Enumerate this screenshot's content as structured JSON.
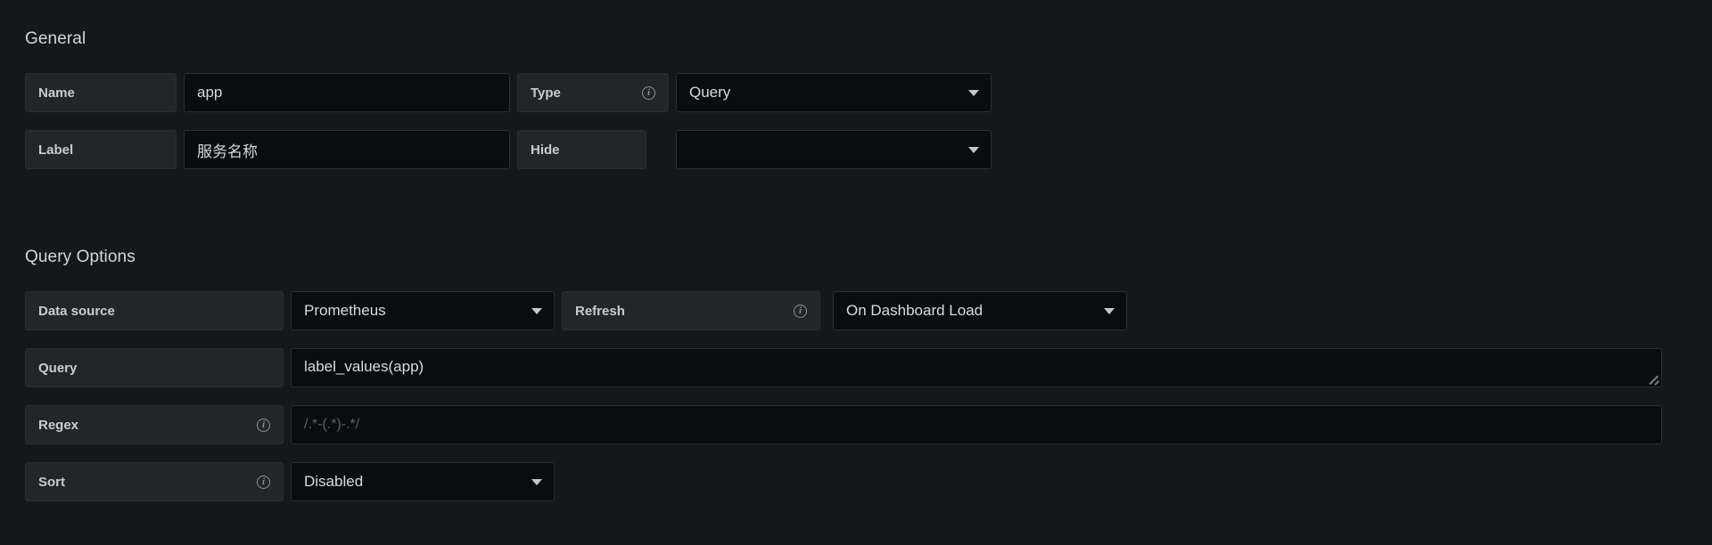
{
  "sections": {
    "general": {
      "title": "General"
    },
    "query_options": {
      "title": "Query Options"
    }
  },
  "general": {
    "name": {
      "label": "Name",
      "value": "app"
    },
    "type": {
      "label": "Type",
      "info_icon": "info-circle-icon",
      "value": "Query",
      "caret_icon": "chevron-down-icon"
    },
    "label_field": {
      "label": "Label",
      "value": "服务名称"
    },
    "hide": {
      "label": "Hide",
      "value": "",
      "caret_icon": "chevron-down-icon"
    }
  },
  "query_options": {
    "data_source": {
      "label": "Data source",
      "value": "Prometheus",
      "caret_icon": "chevron-down-icon"
    },
    "refresh": {
      "label": "Refresh",
      "info_icon": "info-circle-icon",
      "value": "On Dashboard Load",
      "caret_icon": "chevron-down-icon"
    },
    "query": {
      "label": "Query",
      "value": "label_values(app)",
      "resize_handle": "resize-grip-icon"
    },
    "regex": {
      "label": "Regex",
      "info_icon": "info-circle-icon",
      "value": "",
      "placeholder": "/.*-(.*)-.*/"
    },
    "sort": {
      "label": "Sort",
      "info_icon": "info-circle-icon",
      "value": "Disabled",
      "caret_icon": "chevron-down-icon"
    }
  },
  "colors": {
    "page_background": "#16171b",
    "label_cell_background": "#242529",
    "input_background": "#0b0c0e",
    "border": "#2c2d32",
    "text_primary": "#d8dade",
    "text_label": "#c8ccd2",
    "text_muted": "#5d6066",
    "icon_muted": "#8e9097"
  }
}
